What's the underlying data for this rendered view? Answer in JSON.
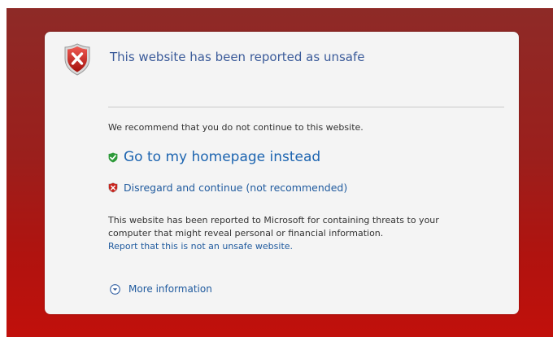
{
  "page": {
    "title": "This website has been reported as unsafe",
    "recommendation": "We recommend that you do not continue to this website.",
    "home_option": "Go to my homepage instead",
    "continue_option": "Disregard and continue (not recommended)",
    "description_line1": "This website has been reported to Microsoft for containing threats to your",
    "description_line2": "computer that might reveal personal or financial information.",
    "report_link": "Report that this is not an unsafe website.",
    "more_info": "More information"
  },
  "icons": {
    "main": "red-shield-x-icon",
    "home": "green-shield-check-icon",
    "continue": "red-shield-x-icon",
    "more": "expand-circle-down-icon"
  },
  "colors": {
    "background_top": "#8e2a27",
    "background_bottom": "#c1100b",
    "card": "#f4f4f4",
    "title": "#3b5b9a",
    "link": "#1f5a9e"
  }
}
